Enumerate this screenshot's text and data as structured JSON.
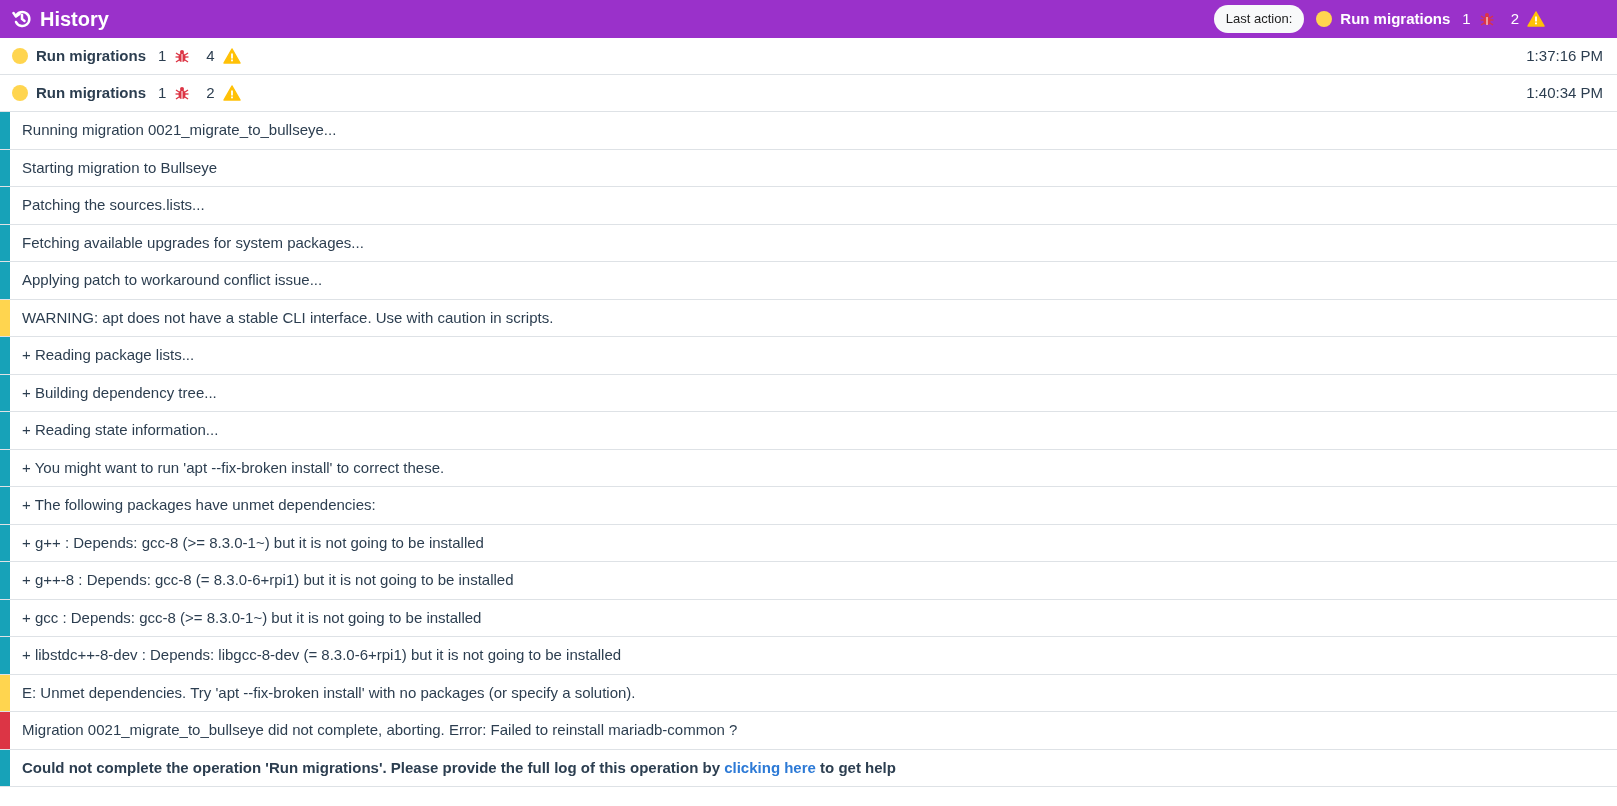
{
  "header": {
    "title": "History",
    "last_action": {
      "label": "Last action:",
      "color": "#ffd54f",
      "name": "Run migrations",
      "errors": "1",
      "warnings": "2"
    }
  },
  "operations": [
    {
      "color": "#ffd54f",
      "name": "Run migrations",
      "errors": "1",
      "warnings": "4",
      "time": "1:37:16 PM"
    },
    {
      "color": "#ffd54f",
      "name": "Run migrations",
      "errors": "1",
      "warnings": "2",
      "time": "1:40:34 PM"
    }
  ],
  "log": [
    {
      "kind": "info",
      "text": "Running migration 0021_migrate_to_bullseye..."
    },
    {
      "kind": "info",
      "text": "Starting migration to Bullseye"
    },
    {
      "kind": "info",
      "text": "Patching the sources.lists..."
    },
    {
      "kind": "info",
      "text": "Fetching available upgrades for system packages..."
    },
    {
      "kind": "info",
      "text": "Applying patch to workaround conflict issue..."
    },
    {
      "kind": "warning",
      "text": "WARNING: apt does not have a stable CLI interface. Use with caution in scripts."
    },
    {
      "kind": "info",
      "text": "+ Reading package lists..."
    },
    {
      "kind": "info",
      "text": "+ Building dependency tree..."
    },
    {
      "kind": "info",
      "text": "+ Reading state information..."
    },
    {
      "kind": "info",
      "text": "+ You might want to run 'apt --fix-broken install' to correct these."
    },
    {
      "kind": "info",
      "text": "+ The following packages have unmet dependencies:"
    },
    {
      "kind": "info",
      "text": "+ g++ : Depends: gcc-8 (>= 8.3.0-1~) but it is not going to be installed"
    },
    {
      "kind": "info",
      "text": "+ g++-8 : Depends: gcc-8 (= 8.3.0-6+rpi1) but it is not going to be installed"
    },
    {
      "kind": "info",
      "text": "+ gcc : Depends: gcc-8 (>= 8.3.0-1~) but it is not going to be installed"
    },
    {
      "kind": "info",
      "text": "+ libstdc++-8-dev : Depends: libgcc-8-dev (= 8.3.0-6+rpi1) but it is not going to be installed"
    },
    {
      "kind": "warning",
      "text": "E: Unmet dependencies. Try 'apt --fix-broken install' with no packages (or specify a solution)."
    },
    {
      "kind": "error",
      "text": "Migration 0021_migrate_to_bullseye did not complete, aborting. Error: Failed to reinstall mariadb-common ?"
    },
    {
      "kind": "info",
      "text": "Could not complete the operation 'Run migrations'. Please provide the full log of this operation by ",
      "link": "clicking here",
      "after": " to get help",
      "bold": true
    }
  ]
}
